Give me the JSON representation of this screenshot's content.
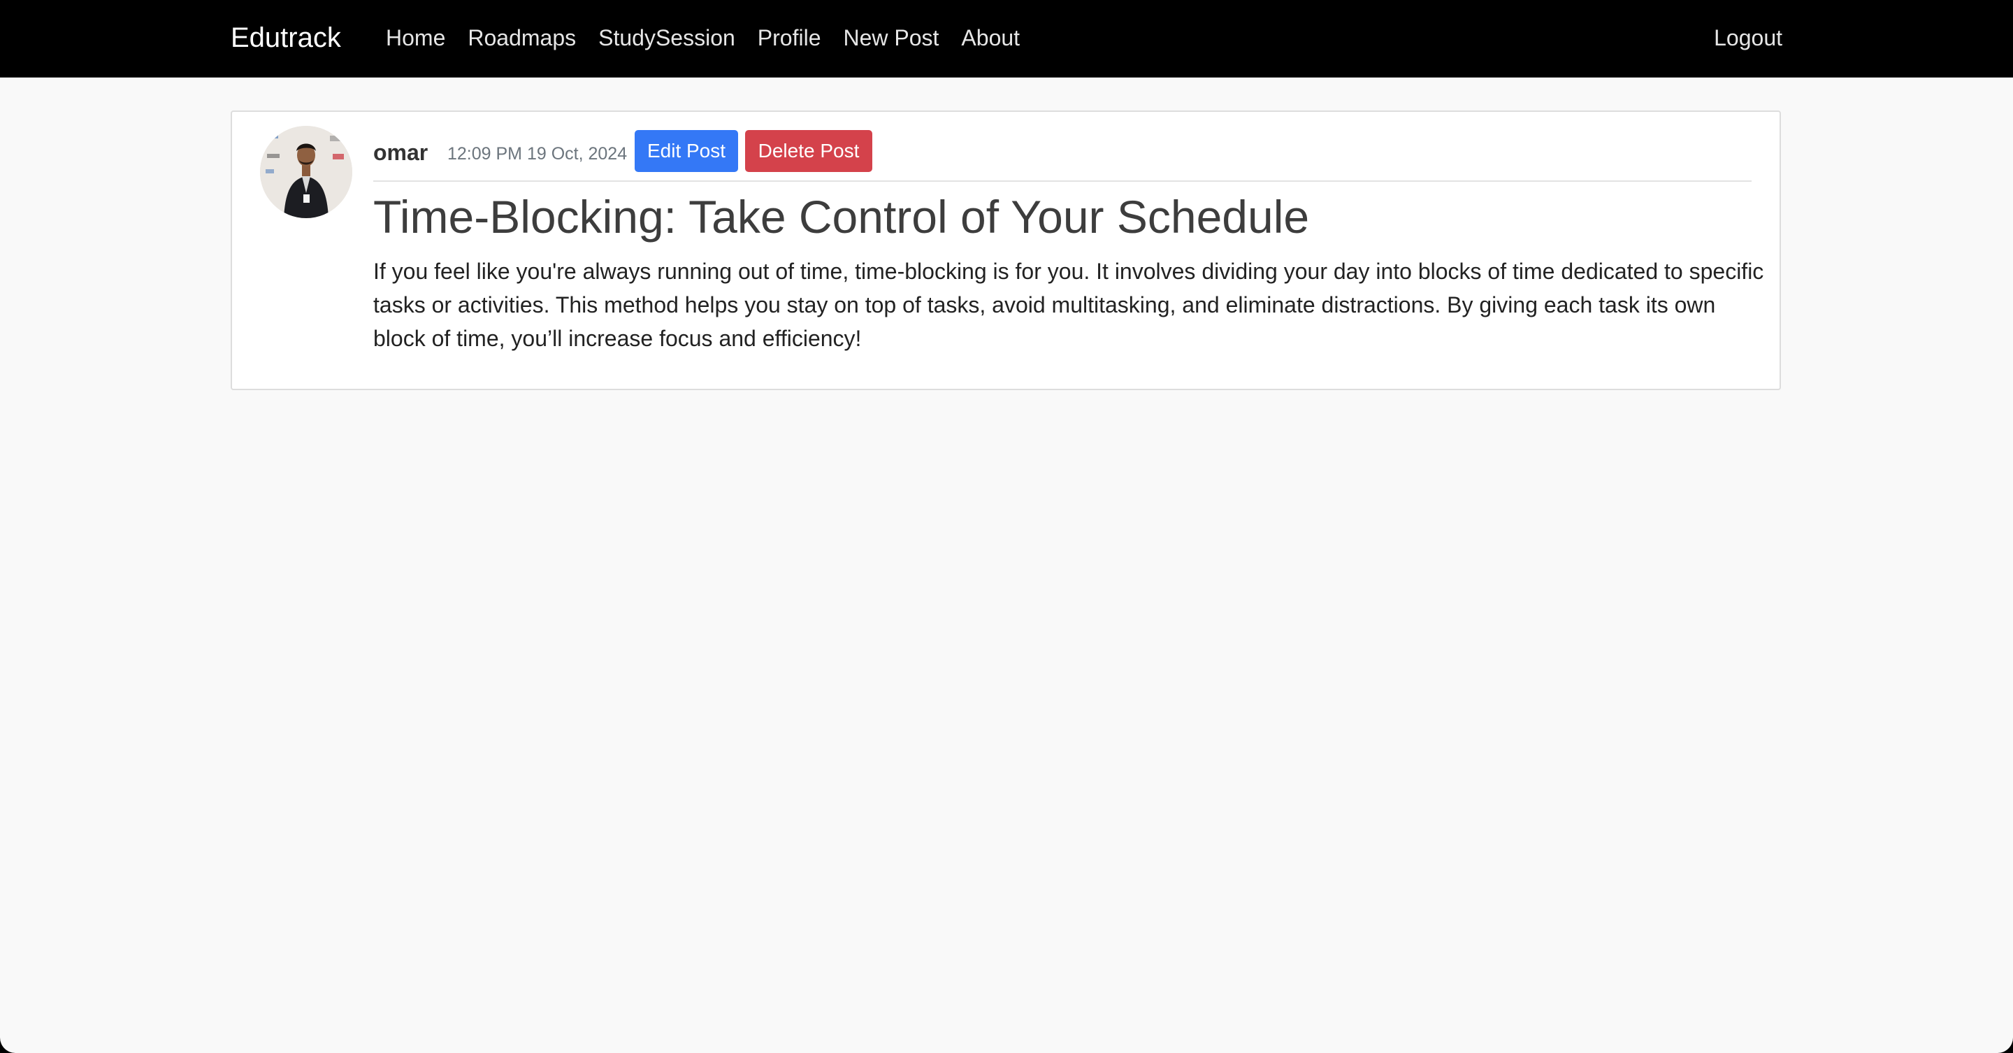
{
  "navbar": {
    "brand": "Edutrack",
    "links": [
      "Home",
      "Roadmaps",
      "StudySession",
      "Profile",
      "New Post",
      "About"
    ],
    "logout_label": "Logout"
  },
  "post": {
    "author": "omar",
    "date": "12:09 PM 19 Oct, 2024",
    "edit_label": "Edit Post",
    "delete_label": "Delete Post",
    "title": "Time-Blocking: Take Control of Your Schedule",
    "content": "If you feel like you're always running out of time, time-blocking is for you. It involves dividing your day into blocks of time dedicated to specific tasks or activities. This method helps you stay on top of tasks, avoid multitasking, and eliminate distractions. By giving each task its own block of time, you’ll increase focus and efficiency!"
  },
  "colors": {
    "navbar_bg": "#000000",
    "page_bg": "#f9f9f9",
    "edit_button": "#3478f6",
    "delete_button": "#d4424b"
  }
}
